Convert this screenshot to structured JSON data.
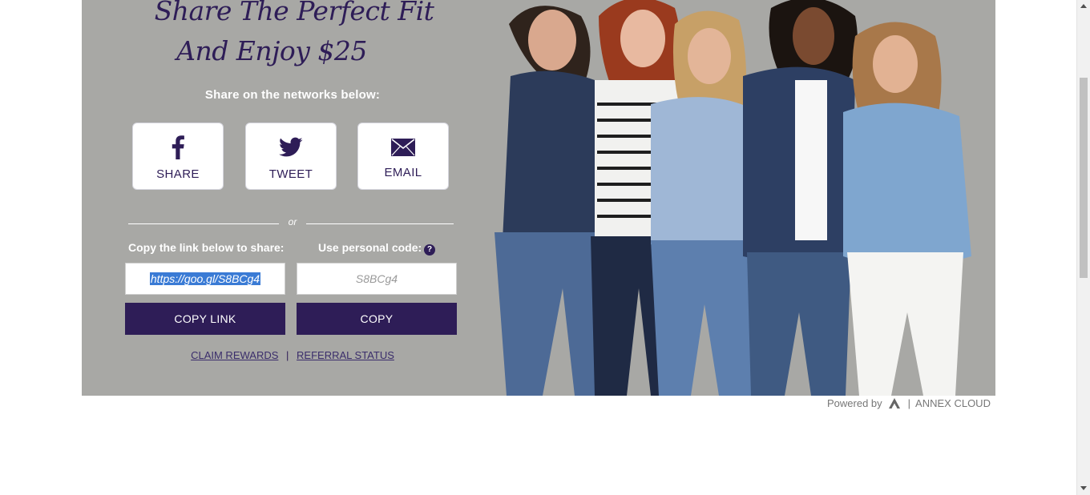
{
  "headline": {
    "line1": "Share The Perfect Fit",
    "line2": "And Enjoy $25"
  },
  "share_prompt": "Share on the networks below:",
  "social_buttons": [
    {
      "label": "SHARE",
      "icon": "facebook-icon"
    },
    {
      "label": "TWEET",
      "icon": "twitter-icon"
    },
    {
      "label": "EMAIL",
      "icon": "envelope-icon"
    }
  ],
  "divider_text": "or",
  "copy_link": {
    "label": "Copy the link below to share:",
    "value": "https://goo.gl/S8BCg4",
    "button_label": "COPY LINK"
  },
  "personal_code": {
    "label": "Use personal code:",
    "help_glyph": "?",
    "value": "S8BCg4",
    "button_label": "COPY"
  },
  "bottom_links": {
    "claim_rewards": "CLAIM REWARDS",
    "separator": "|",
    "referral_status": "REFERRAL STATUS"
  },
  "footer": {
    "powered_by": "Powered by",
    "separator": "|",
    "brand": "ANNEX CLOUD"
  },
  "colors": {
    "accent": "#2e1d57",
    "panel_background": "#a8a8a5",
    "selection_highlight": "#3a7bd5"
  },
  "photo_description_icon": "women-group-photo"
}
